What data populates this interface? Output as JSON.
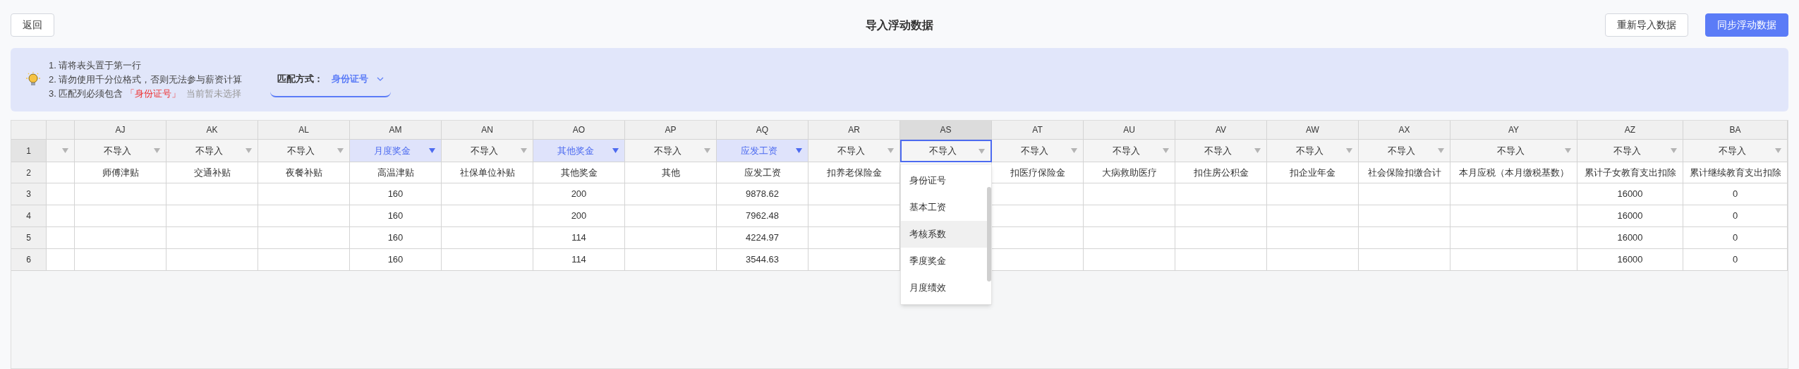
{
  "toolbar": {
    "title": "导入浮动数据",
    "left_buttons": [
      {
        "label": "返回",
        "kind": "default"
      }
    ],
    "right_buttons": [
      {
        "label": "重新导入数据",
        "kind": "default"
      },
      {
        "label": "同步浮动数据",
        "kind": "primary"
      }
    ]
  },
  "notice": {
    "tips": [
      {
        "text": "1. 请将表头置于第一行"
      },
      {
        "text": "2. 请勿使用千分位格式，否则无法参与薪资计算"
      },
      {
        "text": "3. 匹配列必须包含",
        "highlight": "「身份证号」",
        "note": "当前暂未选择"
      }
    ],
    "match": {
      "label": "匹配方式：",
      "value": "身份证号"
    }
  },
  "table": {
    "mapping_row_number": "1",
    "header_row_number": "2",
    "columns": [
      {
        "kind": "clipped",
        "mapped": false,
        "selected": false
      },
      {
        "kind": "column",
        "letter": "AJ",
        "mapping": "不导入",
        "mapped": false,
        "selected": false,
        "header": "师傅津贴"
      },
      {
        "kind": "column",
        "letter": "AK",
        "mapping": "不导入",
        "mapped": false,
        "selected": false,
        "header": "交通补贴"
      },
      {
        "kind": "column",
        "letter": "AL",
        "mapping": "不导入",
        "mapped": false,
        "selected": false,
        "header": "夜餐补贴"
      },
      {
        "kind": "column",
        "letter": "AM",
        "mapping": "月度奖金",
        "mapped": true,
        "selected": false,
        "header": "高温津贴"
      },
      {
        "kind": "column",
        "letter": "AN",
        "mapping": "不导入",
        "mapped": false,
        "selected": false,
        "header": "社保单位补贴"
      },
      {
        "kind": "column",
        "letter": "AO",
        "mapping": "其他奖金",
        "mapped": true,
        "selected": false,
        "header": "其他奖金"
      },
      {
        "kind": "column",
        "letter": "AP",
        "mapping": "不导入",
        "mapped": false,
        "selected": false,
        "header": "其他"
      },
      {
        "kind": "column",
        "letter": "AQ",
        "mapping": "应发工资",
        "mapped": true,
        "selected": false,
        "header": "应发工资"
      },
      {
        "kind": "column",
        "letter": "AR",
        "mapping": "不导入",
        "mapped": false,
        "selected": false,
        "header": "扣养老保险金"
      },
      {
        "kind": "column",
        "letter": "AS",
        "mapping": "不导入",
        "mapped": false,
        "selected": true
      },
      {
        "kind": "column",
        "letter": "AT",
        "mapping": "不导入",
        "mapped": false,
        "selected": false,
        "header": "扣医疗保险金"
      },
      {
        "kind": "column",
        "letter": "AU",
        "mapping": "不导入",
        "mapped": false,
        "selected": false,
        "header": "大病救助医疗"
      },
      {
        "kind": "column",
        "letter": "AV",
        "mapping": "不导入",
        "mapped": false,
        "selected": false,
        "header": "扣住房公积金"
      },
      {
        "kind": "column",
        "letter": "AW",
        "mapping": "不导入",
        "mapped": false,
        "selected": false,
        "header": "扣企业年金"
      },
      {
        "kind": "column",
        "letter": "AX",
        "mapping": "不导入",
        "mapped": false,
        "selected": false,
        "header": "社会保险扣缴合计"
      },
      {
        "kind": "column",
        "letter": "AY",
        "mapping": "不导入",
        "mapped": false,
        "selected": false,
        "header": "本月应税（本月缴税基数）"
      },
      {
        "kind": "column",
        "letter": "AZ",
        "mapping": "不导入",
        "mapped": false,
        "selected": false,
        "header": "累计子女教育支出扣除"
      },
      {
        "kind": "column",
        "letter": "BA",
        "mapping": "不导入",
        "mapped": false,
        "selected": false,
        "header": "累计继续教育支出扣除"
      }
    ],
    "rows": [
      {
        "number": "3",
        "cells": [
          null,
          null,
          null,
          null,
          "160",
          null,
          "200",
          null,
          "9878.62",
          null,
          null,
          null,
          null,
          null,
          null,
          null,
          null,
          "16000",
          "0"
        ]
      },
      {
        "number": "4",
        "cells": [
          null,
          null,
          null,
          null,
          "160",
          null,
          "200",
          null,
          "7962.48",
          null,
          null,
          null,
          null,
          null,
          null,
          null,
          null,
          "16000",
          "0"
        ]
      },
      {
        "number": "5",
        "cells": [
          null,
          null,
          null,
          null,
          "160",
          null,
          "114",
          null,
          "4224.97",
          null,
          null,
          null,
          null,
          null,
          null,
          null,
          null,
          "16000",
          "0"
        ]
      },
      {
        "number": "6",
        "cells": [
          null,
          null,
          null,
          null,
          "160",
          null,
          "114",
          null,
          "3544.63",
          null,
          null,
          null,
          null,
          null,
          null,
          null,
          null,
          "16000",
          "0"
        ]
      }
    ],
    "dropdown": {
      "options": [
        {
          "label": "身份证号",
          "highlighted": false
        },
        {
          "label": "基本工资",
          "highlighted": false
        },
        {
          "label": "考核系数",
          "highlighted": true
        },
        {
          "label": "季度奖金",
          "highlighted": false
        },
        {
          "label": "月度绩效",
          "highlighted": false
        }
      ]
    }
  }
}
